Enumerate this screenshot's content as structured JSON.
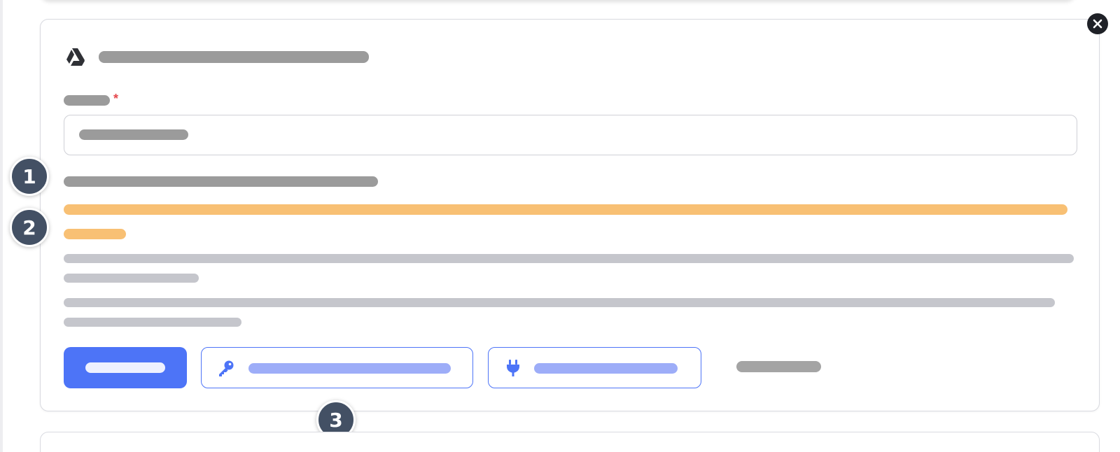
{
  "window": {
    "title": ""
  },
  "icons": {
    "card_icon": "google-drive-icon",
    "close": "close-icon",
    "auth_button_icon": "key-icon",
    "connect_button_icon": "plug-icon"
  },
  "colors": {
    "primary": "#4d74f7",
    "warning": "#f8c074",
    "required": "#e5484d",
    "marker": "#435064",
    "close_button": "#1f2127"
  },
  "form": {
    "required_mark": "*"
  },
  "markers": [
    {
      "label": "1"
    },
    {
      "label": "2"
    },
    {
      "label": "3"
    }
  ]
}
